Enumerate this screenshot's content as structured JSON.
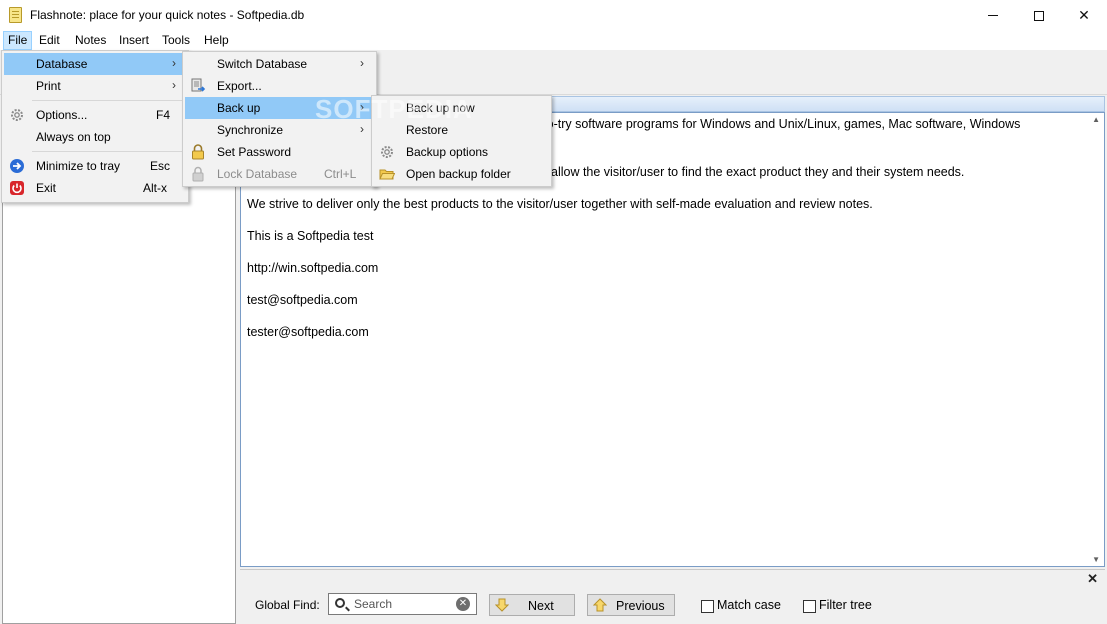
{
  "window": {
    "title": "Flashnote: place for your quick notes - Softpedia.db"
  },
  "menubar": {
    "items": [
      "File",
      "Edit",
      "Notes",
      "Insert",
      "Tools",
      "Help"
    ]
  },
  "file_menu": {
    "database": "Database",
    "print": "Print",
    "options": "Options...",
    "options_shortcut": "F4",
    "always_on_top": "Always on top",
    "minimize": "Minimize to tray",
    "minimize_shortcut": "Esc",
    "exit": "Exit",
    "exit_shortcut": "Alt-x"
  },
  "database_menu": {
    "switch": "Switch Database",
    "export": "Export...",
    "backup": "Back up",
    "synchronize": "Synchronize",
    "set_password": "Set Password",
    "lock": "Lock Database",
    "lock_shortcut": "Ctrl+L"
  },
  "backup_menu": {
    "backup_now": "Back up now",
    "restore": "Restore",
    "options": "Backup options",
    "open_folder": "Open backup folder"
  },
  "editor": {
    "lines": [
      "-to-try software programs for Windows and Unix/Linux, games, Mac software, Windows",
      "allow the visitor/user to find the exact product they and their system needs.",
      "We strive to deliver only the best products to the visitor/user together with self-made evaluation and review notes.",
      "This is a Softpedia test",
      "http://win.softpedia.com",
      "test@softpedia.com",
      "tester@softpedia.com"
    ]
  },
  "findbar": {
    "label": "Global Find:",
    "search_placeholder": "Search",
    "next": "Next",
    "previous": "Previous",
    "match_case": "Match case",
    "filter_tree": "Filter tree"
  },
  "watermark": "SOFTPEDIA",
  "colors": {
    "highlight": "#91c9f7",
    "menu_bg": "#f2f2f2",
    "accent_arrow": "#f2c94c"
  }
}
